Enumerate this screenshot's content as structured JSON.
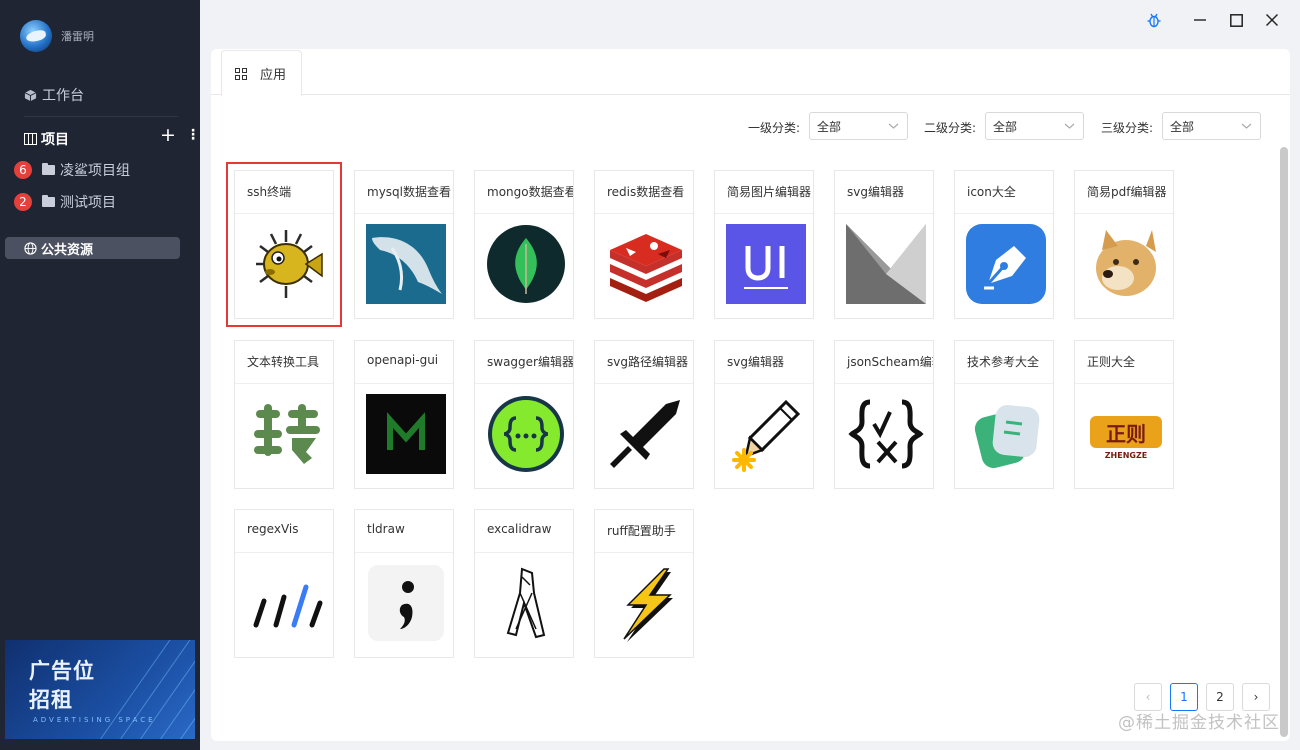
{
  "user": {
    "name": "潘雷明"
  },
  "sidebar": {
    "workbench": "工作台",
    "projects_title": "项目",
    "add_symbol": "+",
    "more_symbol": "⋮",
    "projects": [
      {
        "label": "凌鲨项目组",
        "badge": "6"
      },
      {
        "label": "测试项目",
        "badge": "2"
      }
    ],
    "public_resources": "公共资源",
    "ad": {
      "line1": "广告位",
      "line2": "招租",
      "sub": "ADVERTISING SPACE"
    }
  },
  "window": {
    "debug_icon": "bug-icon",
    "minimize_icon": "minimize-icon",
    "maximize_icon": "maximize-icon",
    "close_icon": "close-icon"
  },
  "tabs": [
    {
      "label": "应用",
      "icon": "grid-icon"
    }
  ],
  "filters": [
    {
      "label": "一级分类:",
      "value": "全部"
    },
    {
      "label": "二级分类:",
      "value": "全部"
    },
    {
      "label": "三级分类:",
      "value": "全部"
    }
  ],
  "apps": [
    {
      "title": "ssh终端",
      "icon": "pufferfish-icon",
      "selected": true
    },
    {
      "title": "mysql数据查看",
      "icon": "mysql-dolphin-icon"
    },
    {
      "title": "mongo数据查看",
      "icon": "mongodb-leaf-icon"
    },
    {
      "title": "redis数据查看",
      "icon": "redis-icon"
    },
    {
      "title": "简易图片编辑器",
      "icon": "ui-icon"
    },
    {
      "title": "svg编辑器",
      "icon": "svg-shape-icon"
    },
    {
      "title": "icon大全",
      "icon": "pen-nib-icon"
    },
    {
      "title": "简易pdf编辑器",
      "icon": "doge-icon"
    },
    {
      "title": "文本转换工具",
      "icon": "zhuan-char-icon"
    },
    {
      "title": "openapi-gui",
      "icon": "m-letter-icon"
    },
    {
      "title": "swagger编辑器",
      "icon": "swagger-icon"
    },
    {
      "title": "svg路径编辑器",
      "icon": "sword-icon"
    },
    {
      "title": "svg编辑器",
      "icon": "pencil-icon"
    },
    {
      "title": "jsonScheam编辑器",
      "icon": "json-braces-icon"
    },
    {
      "title": "技术参考大全",
      "icon": "docs-icon"
    },
    {
      "title": "正则大全",
      "icon": "zhengze-logo-icon",
      "logo_text": "ZHENGZE"
    },
    {
      "title": "regexVis",
      "icon": "regex-slashes-icon"
    },
    {
      "title": "tldraw",
      "icon": "tldraw-icon"
    },
    {
      "title": "excalidraw",
      "icon": "excalidraw-icon"
    },
    {
      "title": "ruff配置助手",
      "icon": "lightning-icon"
    }
  ],
  "pagination": {
    "prev": "‹",
    "pages": [
      "1",
      "2"
    ],
    "current": "1",
    "next": "›"
  },
  "watermark": "@稀土掘金技术社区"
}
